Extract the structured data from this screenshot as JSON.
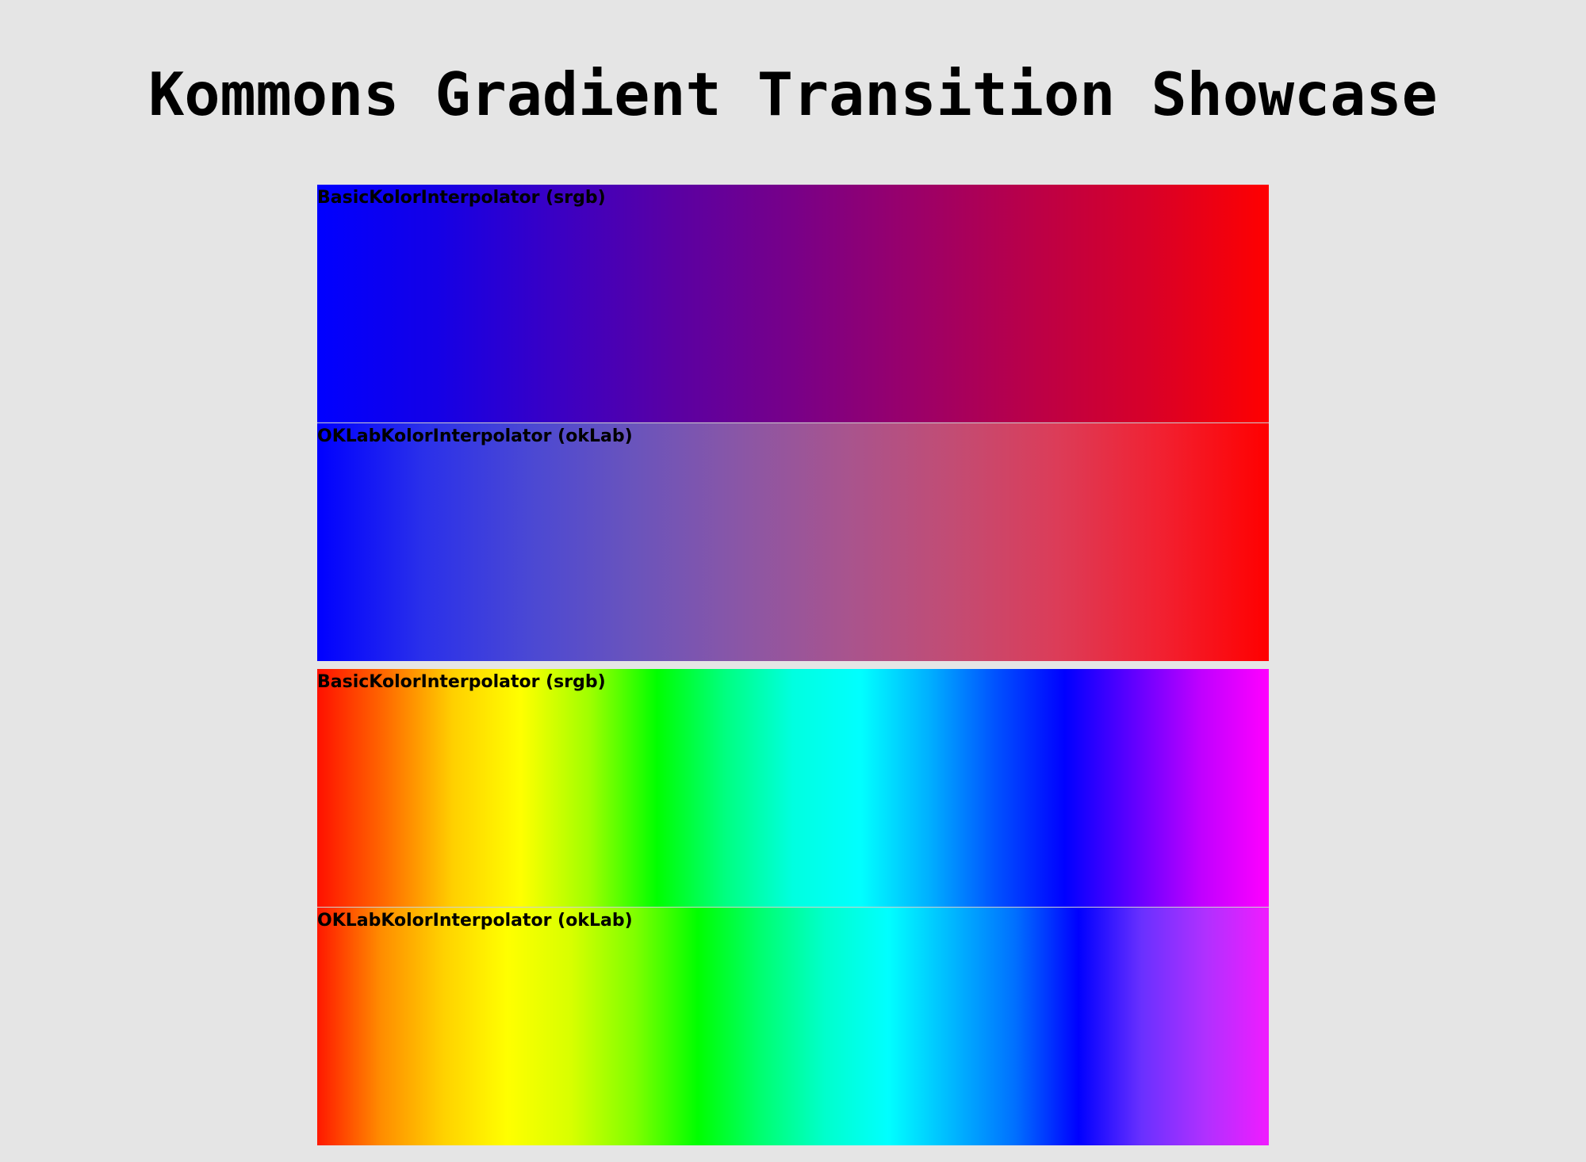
{
  "page": {
    "title": "Kommons Gradient Transition Showcase"
  },
  "groups": [
    {
      "bands": [
        {
          "label": "BasicKolorInterpolator (srgb)",
          "stops": [
            "#0000ff",
            "#1400e6",
            "#3a00c4",
            "#5a00a3",
            "#780088",
            "#9a006a",
            "#ba0048",
            "#d80028",
            "#ff0000"
          ]
        },
        {
          "label": "OKLabKolorInterpolator (okLab)",
          "stops": [
            "#0000ff",
            "#2a30ea",
            "#4a48d4",
            "#6a54bc",
            "#8a56a6",
            "#a8548e",
            "#c24c74",
            "#dc3c58",
            "#f22030",
            "#ff0000"
          ]
        }
      ]
    },
    {
      "bands": [
        {
          "label": "BasicKolorInterpolator (srgb)",
          "stops": [
            "#ff1000",
            "#ff6a00",
            "#ffd000",
            "#ffff00",
            "#a0ff00",
            "#00ff00",
            "#00ff80",
            "#00ffe0",
            "#00ffff",
            "#00b0ff",
            "#0050ff",
            "#0000ff",
            "#6000ff",
            "#c000ff",
            "#ff00ff"
          ]
        },
        {
          "label": "OKLabKolorInterpolator (okLab)",
          "stops": [
            "#ff1800",
            "#ff8c00",
            "#ffd200",
            "#ffff00",
            "#d8ff00",
            "#80ff00",
            "#00ff00",
            "#00ff70",
            "#00ffcc",
            "#00ffff",
            "#00b8ff",
            "#0070ff",
            "#0000ff",
            "#6a30ff",
            "#b030ff",
            "#f01cff"
          ]
        }
      ]
    }
  ]
}
